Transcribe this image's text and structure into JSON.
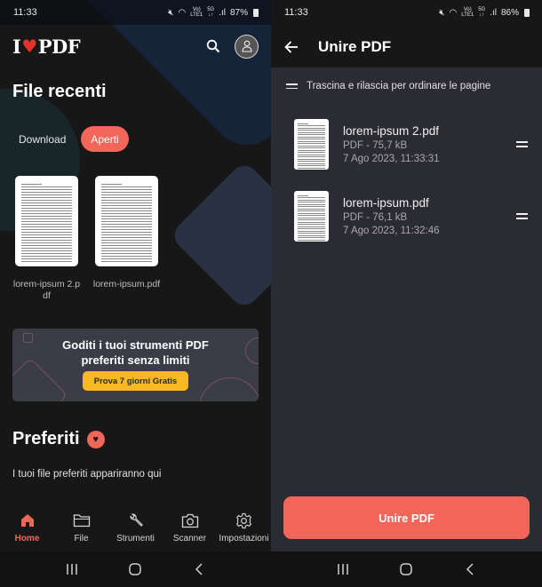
{
  "left": {
    "status": {
      "time": "11:33",
      "battery": "87%"
    },
    "logo": {
      "text_i": "I",
      "text_pdf": "PDF"
    },
    "recent": {
      "title": "File recenti",
      "tabs": [
        {
          "label": "Download",
          "active": false
        },
        {
          "label": "Aperti",
          "active": true
        }
      ],
      "files": [
        {
          "name": "lorem-ipsum 2.pdf"
        },
        {
          "name": "lorem-ipsum.pdf"
        }
      ]
    },
    "promo": {
      "line1": "Goditi i tuoi strumenti PDF",
      "line2": "preferiti senza limiti",
      "button": "Prova 7 giorni Gratis"
    },
    "favorites": {
      "title": "Preferiti",
      "empty_text": "I tuoi file preferiti appariranno qui"
    },
    "bottom_nav": [
      {
        "label": "Home",
        "icon": "home-icon",
        "active": true
      },
      {
        "label": "File",
        "icon": "folder-icon",
        "active": false
      },
      {
        "label": "Strumenti",
        "icon": "wrench-icon",
        "active": false
      },
      {
        "label": "Scanner",
        "icon": "camera-icon",
        "active": false
      },
      {
        "label": "Impostazioni",
        "icon": "gear-icon",
        "active": false
      }
    ]
  },
  "right": {
    "status": {
      "time": "11:33",
      "battery": "86%"
    },
    "header": {
      "title": "Unire PDF"
    },
    "hint": "Trascina e rilascia per ordinare le pagine",
    "files": [
      {
        "name": "lorem-ipsum 2.pdf",
        "size": "PDF - 75,7 kB",
        "date": "7 Ago 2023, 11:33:31"
      },
      {
        "name": "lorem-ipsum.pdf",
        "size": "PDF - 76,1 kB",
        "date": "7 Ago 2023, 11:32:46"
      }
    ],
    "merge_button": "Unire PDF"
  },
  "colors": {
    "accent": "#f2665a",
    "promo_button": "#f7b824",
    "background": "#171718",
    "panel": "#2b2b33"
  }
}
